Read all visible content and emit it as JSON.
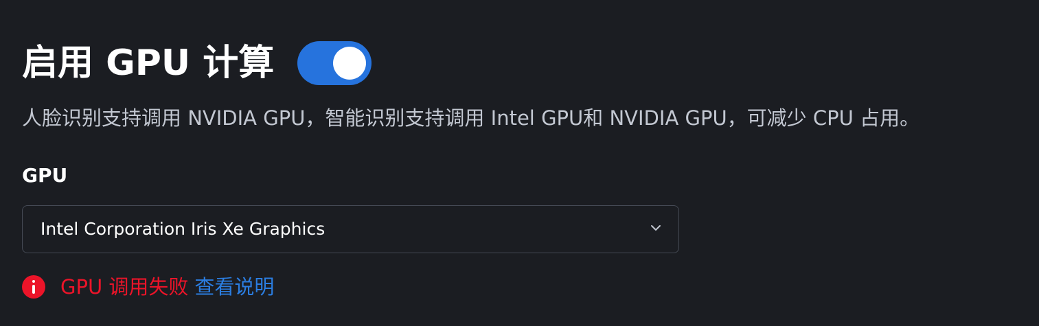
{
  "header": {
    "title": "启用 GPU 计算",
    "gpu_compute_enabled": true
  },
  "description": "人脸识别支持调用 NVIDIA GPU，智能识别支持调用 Intel GPU和 NVIDIA GPU，可减少 CPU 占用。",
  "gpu_field": {
    "label": "GPU",
    "selected_value": "Intel Corporation Iris Xe Graphics"
  },
  "status": {
    "error_text": "GPU 调用失败",
    "help_link_text": "查看说明"
  },
  "colors": {
    "background": "#1b1d22",
    "accent": "#2673dd",
    "error": "#ec1429",
    "link": "#2b7de0"
  },
  "icons": {
    "dropdown": "chevron-down-icon",
    "error": "error-icon"
  }
}
